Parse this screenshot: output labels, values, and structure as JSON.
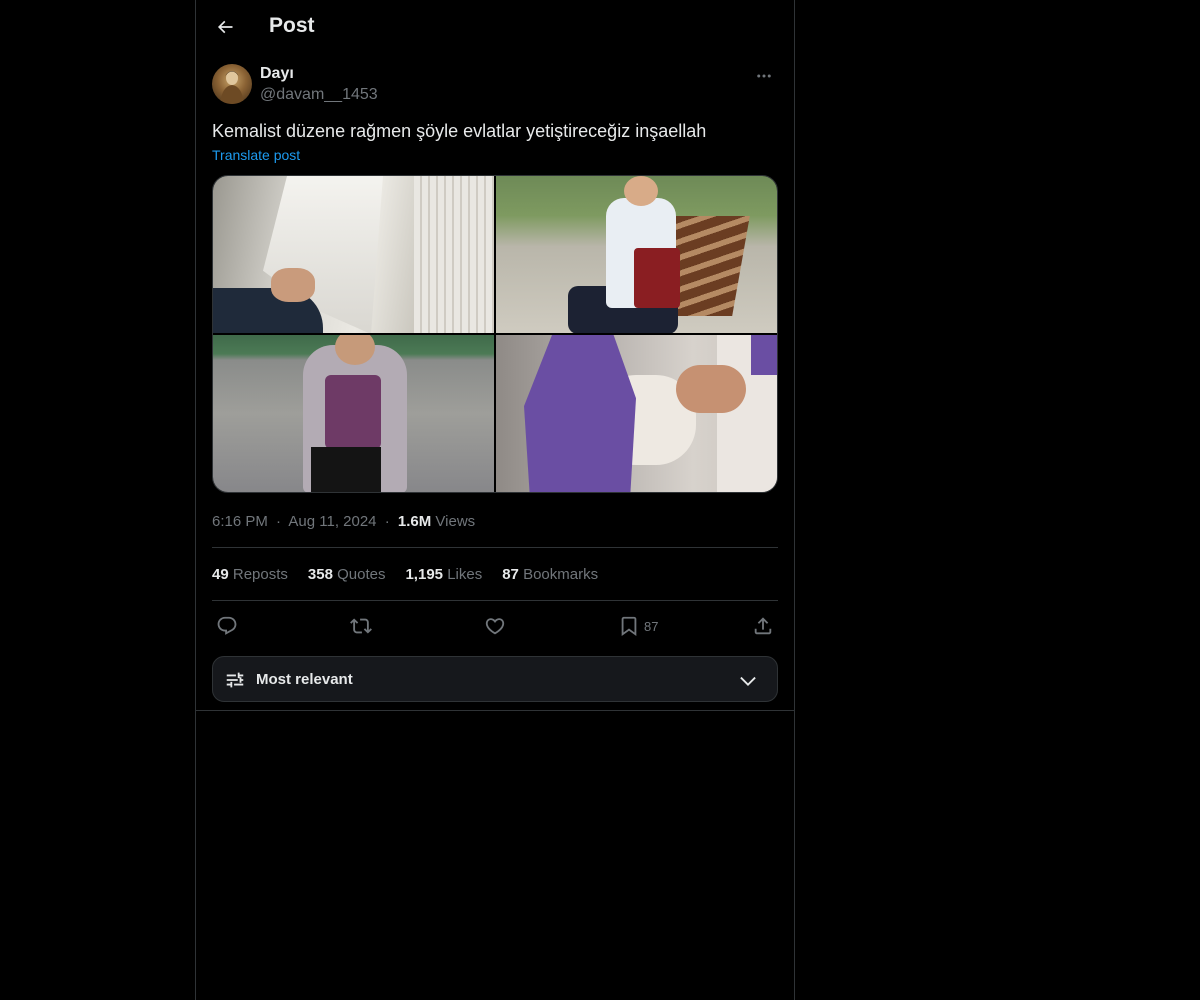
{
  "header": {
    "title": "Post"
  },
  "post": {
    "author": {
      "name": "Dayı",
      "handle": "@davam__1453"
    },
    "text": "Kemalist düzene rağmen şöyle evlatlar yetiştireceğiz inşaellah",
    "translate_label": "Translate post",
    "media": {
      "photos": [
        "photo-1",
        "photo-2",
        "photo-3",
        "photo-4"
      ]
    },
    "meta": {
      "time": "6:16 PM",
      "date": "Aug 11, 2024",
      "separator": "·",
      "views_count": "1.6M",
      "views_label": "Views"
    },
    "stats": {
      "reposts_count": "49",
      "reposts_label": "Reposts",
      "quotes_count": "358",
      "quotes_label": "Quotes",
      "likes_count": "1,195",
      "likes_label": "Likes",
      "bookmarks_count": "87",
      "bookmarks_label": "Bookmarks"
    },
    "actions": {
      "reply_icon": "reply-icon",
      "repost_icon": "repost-icon",
      "like_icon": "heart-icon",
      "bookmark_icon": "bookmark-icon",
      "bookmark_count": "87",
      "share_icon": "share-icon"
    }
  },
  "replies": {
    "sort_label": "Most relevant",
    "sort_icon": "sliders-icon",
    "chevron_icon": "chevron-down-icon"
  },
  "colors": {
    "background": "#000000",
    "text_primary": "#e7e9ea",
    "text_secondary": "#71767b",
    "accent": "#1d9bf0",
    "border": "#2f3336"
  }
}
